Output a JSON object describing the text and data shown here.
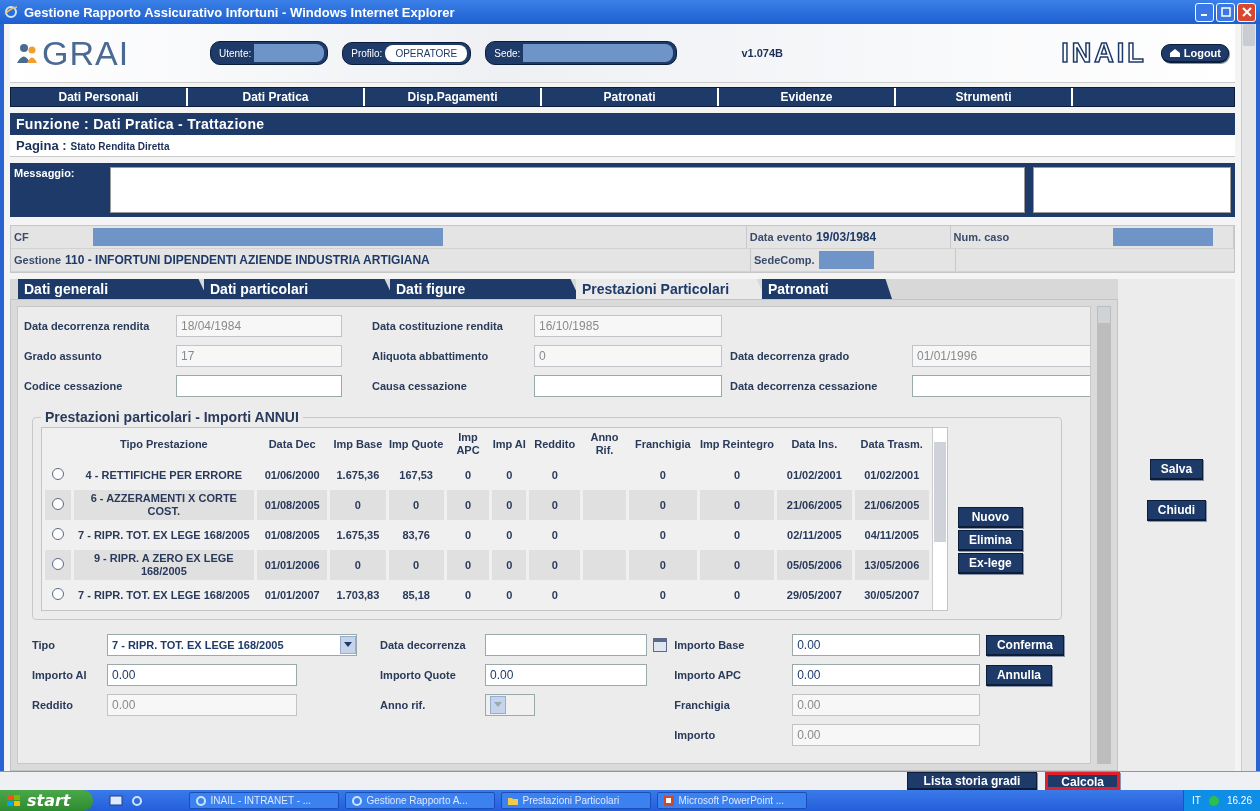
{
  "window": {
    "title": "Gestione Rapporto Assicurativo Infortuni - Windows Internet Explorer"
  },
  "header": {
    "logo": "GRAI",
    "fields": [
      {
        "label": "Utente:",
        "kind": "redacted"
      },
      {
        "label": "Profilo:",
        "kind": "value",
        "value": "OPERATORE"
      },
      {
        "label": "Sede:",
        "kind": "redacted"
      }
    ],
    "version": "v1.074B",
    "brand": "INAIL",
    "logout": "Logout"
  },
  "menu": [
    "Dati Personali",
    "Dati Pratica",
    "Disp.Pagamenti",
    "Patronati",
    "Evidenze",
    "Strumenti"
  ],
  "function_bar": "Funzione : Dati Pratica - Trattazione",
  "page_bar": {
    "label": "Pagina :",
    "value": "Stato Rendita Diretta"
  },
  "message": {
    "label": "Messaggio:"
  },
  "case_info": [
    {
      "fields": [
        {
          "label": "CF",
          "kind": "redacted"
        },
        {
          "label": "Data evento",
          "kind": "value",
          "value": "19/03/1984"
        },
        {
          "label": "Num. caso",
          "kind": "redacted"
        }
      ]
    },
    {
      "fields": [
        {
          "label": "Gestione",
          "kind": "value",
          "value": "110 - INFORTUNI DIPENDENTI AZIENDE INDUSTRIA ARTIGIANA"
        },
        {
          "label": "SedeComp.",
          "kind": "redacted"
        }
      ]
    }
  ],
  "tabs": [
    {
      "label": "Dati generali",
      "selected": false
    },
    {
      "label": "Dati particolari",
      "selected": false
    },
    {
      "label": "Dati figure",
      "selected": false
    },
    {
      "label": "Prestazioni Particolari",
      "selected": true
    },
    {
      "label": "Patronati",
      "selected": false
    }
  ],
  "form": {
    "rows": [
      [
        {
          "label": "Data decorrenza rendita",
          "value": "18/04/1984",
          "disabled": true
        },
        {
          "label": "Data costituzione rendita",
          "value": "16/10/1985",
          "disabled": true
        }
      ],
      [
        {
          "label": "Grado assunto",
          "value": "17",
          "disabled": true
        },
        {
          "label": "Aliquota abbattimento",
          "value": "0",
          "disabled": true
        },
        {
          "label": "Data decorrenza grado",
          "value": "01/01/1996",
          "disabled": true
        }
      ],
      [
        {
          "label": "Codice cessazione",
          "disabled": false
        },
        {
          "label": "Causa cessazione",
          "disabled": false
        },
        {
          "label": "Data decorrenza cessazione",
          "disabled": false
        }
      ]
    ]
  },
  "group": {
    "title": "Prestazioni particolari - Importi ANNUI",
    "columns": [
      "Tipo Prestazione",
      "Data Dec",
      "Imp Base",
      "Imp Quote",
      "Imp APC",
      "Imp AI",
      "Reddito",
      "Anno Rif.",
      "Franchigia",
      "Imp Reintegro",
      "Data Ins.",
      "Data Trasm."
    ],
    "rows": [
      {
        "selected": false,
        "cells": [
          "4 - RETTIFICHE PER ERRORE",
          "01/06/2000",
          "1.675,36",
          "167,53",
          "0",
          "0",
          "0",
          null,
          "0",
          "0",
          "01/02/2001",
          "01/02/2001"
        ]
      },
      {
        "selected": false,
        "cells": [
          "6 - AZZERAMENTI X CORTE COST.",
          "01/08/2005",
          "0",
          "0",
          "0",
          "0",
          "0",
          null,
          "0",
          "0",
          "21/06/2005",
          "21/06/2005"
        ]
      },
      {
        "selected": false,
        "cells": [
          "7 - RIPR. TOT. EX LEGE 168/2005",
          "01/08/2005",
          "1.675,35",
          "83,76",
          "0",
          "0",
          "0",
          null,
          "0",
          "0",
          "02/11/2005",
          "04/11/2005"
        ]
      },
      {
        "selected": false,
        "cells": [
          "9 - RIPR. A ZERO EX LEGE 168/2005",
          "01/01/2006",
          "0",
          "0",
          "0",
          "0",
          "0",
          null,
          "0",
          "0",
          "05/05/2006",
          "13/05/2006"
        ]
      },
      {
        "selected": false,
        "cells": [
          "7 - RIPR. TOT. EX LEGE 168/2005",
          "01/01/2007",
          "1.703,83",
          "85,18",
          "0",
          "0",
          "0",
          null,
          "0",
          "0",
          "29/05/2007",
          "30/05/2007"
        ]
      }
    ],
    "buttons": [
      "Nuovo",
      "Elimina",
      "Ex-lege"
    ]
  },
  "side_buttons": [
    "Salva",
    "Chiudi"
  ],
  "bottom": {
    "columns": [
      [
        {
          "kind": "select",
          "label": "Tipo",
          "value": "7 - RIPR. TOT. EX LEGE 168/2005",
          "disabled": false
        },
        {
          "kind": "text",
          "label": "Importo AI",
          "value": "0.00",
          "disabled": false
        },
        {
          "kind": "text",
          "label": "Reddito",
          "value": "0.00",
          "disabled": true
        }
      ],
      [
        {
          "kind": "date",
          "label": "Data decorrenza",
          "disabled": false
        },
        {
          "kind": "text",
          "label": "Importo Quote",
          "value": "0.00",
          "disabled": false
        },
        {
          "kind": "select",
          "label": "Anno rif.",
          "disabled": true
        }
      ],
      [
        {
          "kind": "text",
          "label": "Importo Base",
          "value": "0.00",
          "disabled": false
        },
        {
          "kind": "text",
          "label": "Importo APC",
          "value": "0.00",
          "disabled": false
        },
        {
          "kind": "text",
          "label": "Franchigia",
          "value": "0.00",
          "disabled": true
        },
        {
          "kind": "text",
          "label": "Importo",
          "value": "0.00",
          "disabled": true
        }
      ],
      [
        {
          "kind": "button",
          "label": "Conferma"
        },
        {
          "kind": "button",
          "label": "Annulla"
        }
      ]
    ]
  },
  "footer": {
    "buttons": [
      {
        "label": "Lista storia gradi",
        "highlighted": false
      },
      {
        "label": "Calcola",
        "highlighted": true
      }
    ]
  },
  "taskbar": {
    "start": "start",
    "tasks": [
      {
        "kind": "browser",
        "label": "INAIL - INTRANET - ..."
      },
      {
        "kind": "browser",
        "label": "Gestione Rapporto A..."
      },
      {
        "kind": "folder",
        "label": "Prestazioni Particolari"
      },
      {
        "kind": "slides",
        "label": "Microsoft PowerPoint ..."
      }
    ],
    "language": "IT",
    "clock": "16.26"
  }
}
